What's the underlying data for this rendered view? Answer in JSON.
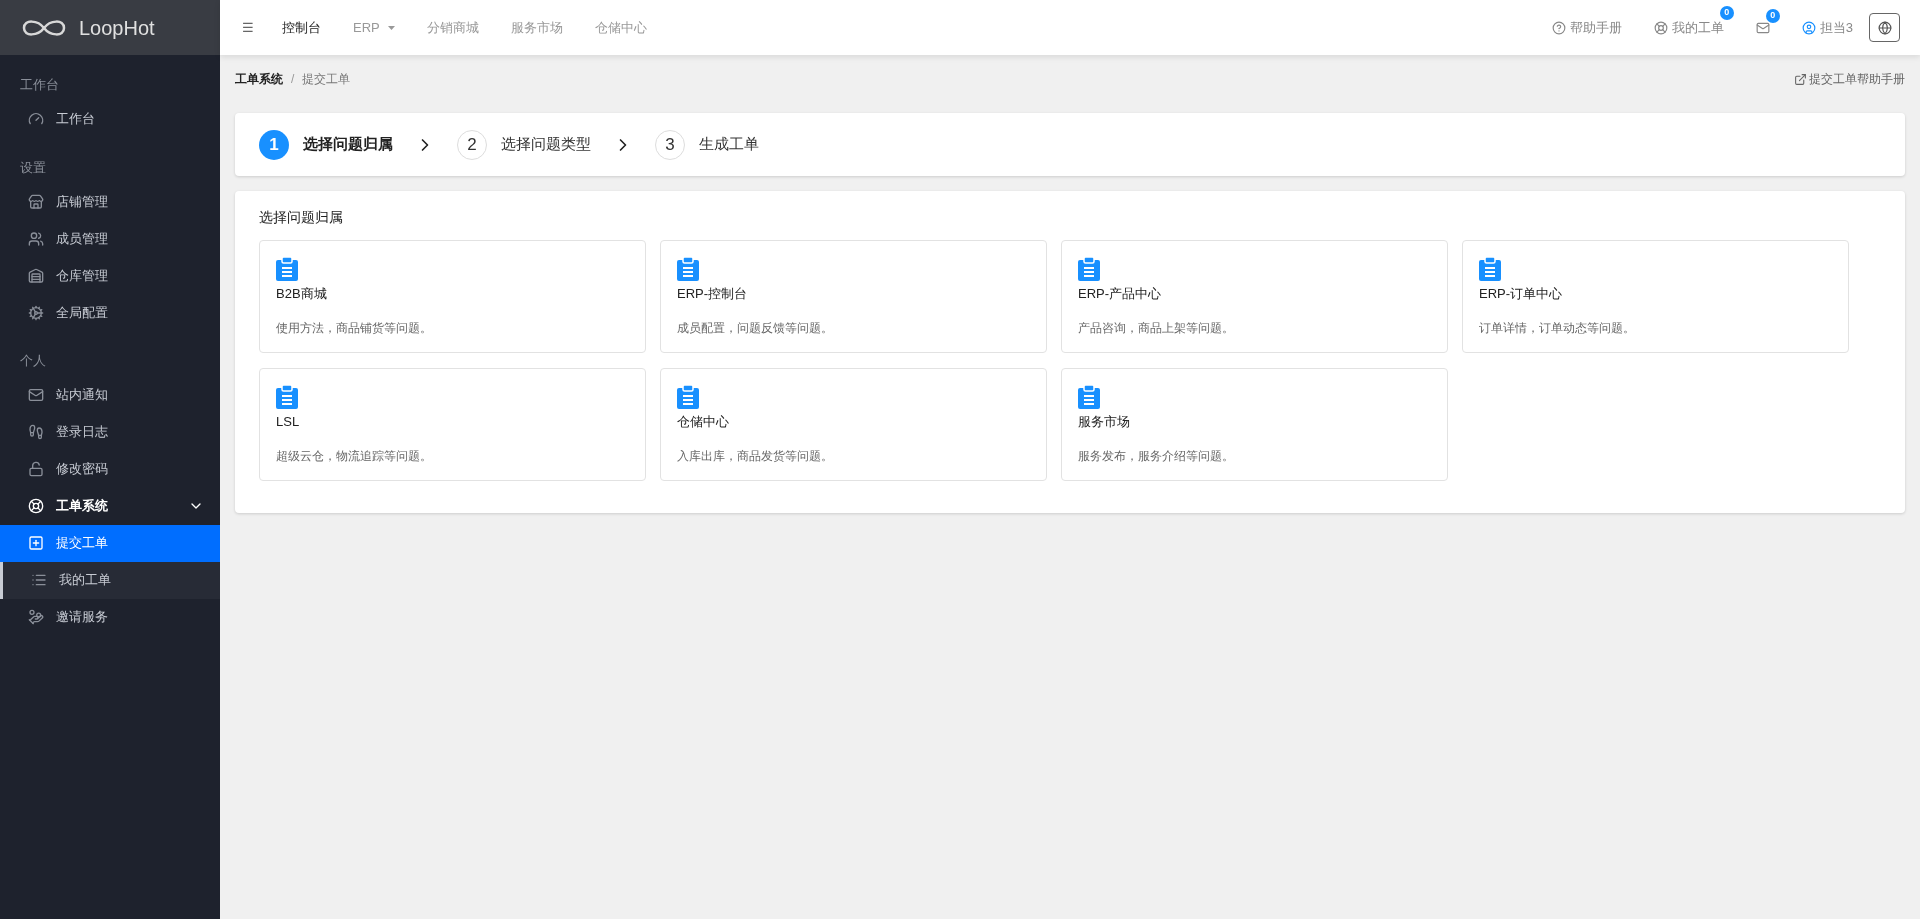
{
  "brand": {
    "name": "LoopHot"
  },
  "sidebar": {
    "groups": [
      {
        "label": "工作台",
        "items": [
          {
            "kind": "gauge",
            "label": "工作台",
            "selected": false
          }
        ]
      },
      {
        "label": "设置",
        "items": [
          {
            "kind": "store",
            "label": "店铺管理",
            "selected": false
          },
          {
            "kind": "users",
            "label": "成员管理",
            "selected": false
          },
          {
            "kind": "warehouse",
            "label": "仓库管理",
            "selected": false
          },
          {
            "kind": "cogs",
            "label": "全局配置",
            "selected": false
          }
        ]
      },
      {
        "label": "个人",
        "items": [
          {
            "kind": "mail",
            "label": "站内通知",
            "selected": false
          },
          {
            "kind": "steps",
            "label": "登录日志",
            "selected": false
          },
          {
            "kind": "unlock",
            "label": "修改密码",
            "selected": false
          },
          {
            "kind": "buoy",
            "label": "工单系统",
            "selected": false,
            "expanded": true,
            "children": [
              {
                "kind": "plus",
                "label": "提交工单",
                "selected": true
              },
              {
                "kind": "list",
                "label": "我的工单",
                "selected": false
              }
            ]
          },
          {
            "kind": "hand",
            "label": "邀请服务",
            "selected": false
          }
        ]
      }
    ]
  },
  "topbar": {
    "menu_glyph": "☰",
    "nav": [
      {
        "label": "控制台",
        "selected": true,
        "dropdown": false
      },
      {
        "label": "ERP",
        "selected": false,
        "dropdown": true
      },
      {
        "label": "分销商城",
        "selected": false,
        "dropdown": false
      },
      {
        "label": "服务市场",
        "selected": false,
        "dropdown": false
      },
      {
        "label": "仓储中心",
        "selected": false,
        "dropdown": false
      }
    ],
    "right": [
      {
        "kind": "help",
        "label": "帮助手册"
      },
      {
        "kind": "buoy",
        "label": "我的工单",
        "badge": "0"
      },
      {
        "kind": "mail",
        "badge": "0"
      },
      {
        "kind": "user",
        "label": "担当3"
      }
    ]
  },
  "breadcrumb": {
    "items": [
      "工单系统",
      "提交工单"
    ],
    "separator": "/",
    "help_link": "提交工单帮助手册"
  },
  "steps": [
    {
      "number": "1",
      "label": "选择问题归属",
      "selected": true
    },
    {
      "number": "2",
      "label": "选择问题类型",
      "selected": false
    },
    {
      "number": "3",
      "label": "生成工单",
      "selected": false
    }
  ],
  "panel": {
    "title": "选择问题归属",
    "cards": [
      {
        "title": "B2B商城",
        "description": "使用方法，商品铺货等问题。"
      },
      {
        "title": "ERP-控制台",
        "description": "成员配置，问题反馈等问题。"
      },
      {
        "title": "ERP-产品中心",
        "description": "产品咨询，商品上架等问题。"
      },
      {
        "title": "ERP-订单中心",
        "description": "订单详情，订单动态等问题。"
      },
      {
        "title": "LSL",
        "description": "超级云仓，物流追踪等问题。"
      },
      {
        "title": "仓储中心",
        "description": "入库出库，商品发货等问题。"
      },
      {
        "title": "服务市场",
        "description": "服务发布，服务介绍等问题。"
      }
    ]
  }
}
